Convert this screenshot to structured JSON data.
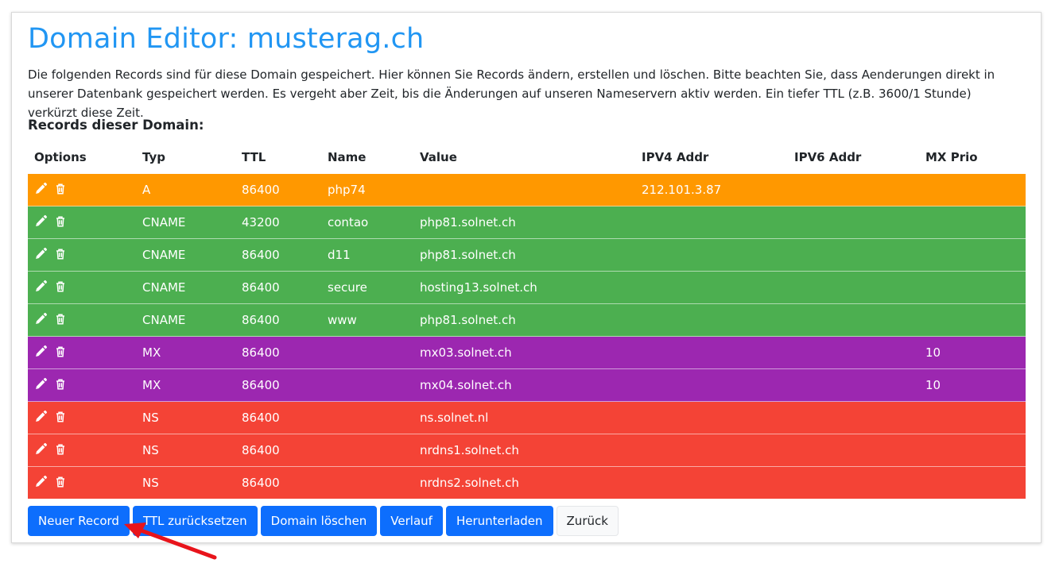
{
  "page": {
    "title": "Domain Editor: musterag.ch",
    "intro": "Die folgenden Records sind für diese Domain gespeichert. Hier können Sie Records ändern, erstellen und löschen. Bitte beachten Sie, dass Aenderungen direkt in unserer Datenbank gespeichert werden. Es vergeht aber Zeit, bis die Änderungen auf unseren Nameservern aktiv werden. Ein tiefer TTL (z.B. 3600/1 Stunde) verkürzt diese Zeit.",
    "records_heading": "Records dieser Domain:"
  },
  "table": {
    "headers": {
      "options": "Options",
      "type": "Typ",
      "ttl": "TTL",
      "name": "Name",
      "value": "Value",
      "ipv4": "IPV4 Addr",
      "ipv6": "IPV6 Addr",
      "mxprio": "MX Prio"
    },
    "row_colors": {
      "A": "#ff9800",
      "CNAME": "#4caf50",
      "MX": "#9c27b0",
      "NS": "#f44336"
    },
    "icons": {
      "edit": "pencil-icon",
      "delete": "trash-icon"
    },
    "rows": [
      {
        "type": "A",
        "ttl": "86400",
        "name": "php74",
        "value": "",
        "ipv4": "212.101.3.87",
        "ipv6": "",
        "mxprio": ""
      },
      {
        "type": "CNAME",
        "ttl": "43200",
        "name": "contao",
        "value": "php81.solnet.ch",
        "ipv4": "",
        "ipv6": "",
        "mxprio": ""
      },
      {
        "type": "CNAME",
        "ttl": "86400",
        "name": "d11",
        "value": "php81.solnet.ch",
        "ipv4": "",
        "ipv6": "",
        "mxprio": ""
      },
      {
        "type": "CNAME",
        "ttl": "86400",
        "name": "secure",
        "value": "hosting13.solnet.ch",
        "ipv4": "",
        "ipv6": "",
        "mxprio": ""
      },
      {
        "type": "CNAME",
        "ttl": "86400",
        "name": "www",
        "value": "php81.solnet.ch",
        "ipv4": "",
        "ipv6": "",
        "mxprio": ""
      },
      {
        "type": "MX",
        "ttl": "86400",
        "name": "",
        "value": "mx03.solnet.ch",
        "ipv4": "",
        "ipv6": "",
        "mxprio": "10"
      },
      {
        "type": "MX",
        "ttl": "86400",
        "name": "",
        "value": "mx04.solnet.ch",
        "ipv4": "",
        "ipv6": "",
        "mxprio": "10"
      },
      {
        "type": "NS",
        "ttl": "86400",
        "name": "",
        "value": "ns.solnet.nl",
        "ipv4": "",
        "ipv6": "",
        "mxprio": ""
      },
      {
        "type": "NS",
        "ttl": "86400",
        "name": "",
        "value": "nrdns1.solnet.ch",
        "ipv4": "",
        "ipv6": "",
        "mxprio": ""
      },
      {
        "type": "NS",
        "ttl": "86400",
        "name": "",
        "value": "nrdns2.solnet.ch",
        "ipv4": "",
        "ipv6": "",
        "mxprio": ""
      }
    ]
  },
  "buttons": {
    "new_record": "Neuer Record",
    "reset_ttl": "TTL zurücksetzen",
    "delete_domain": "Domain löschen",
    "history": "Verlauf",
    "download": "Herunterladen",
    "back": "Zurück"
  },
  "annotation": {
    "arrow_color": "#e8141b",
    "points_to": "new_record"
  }
}
